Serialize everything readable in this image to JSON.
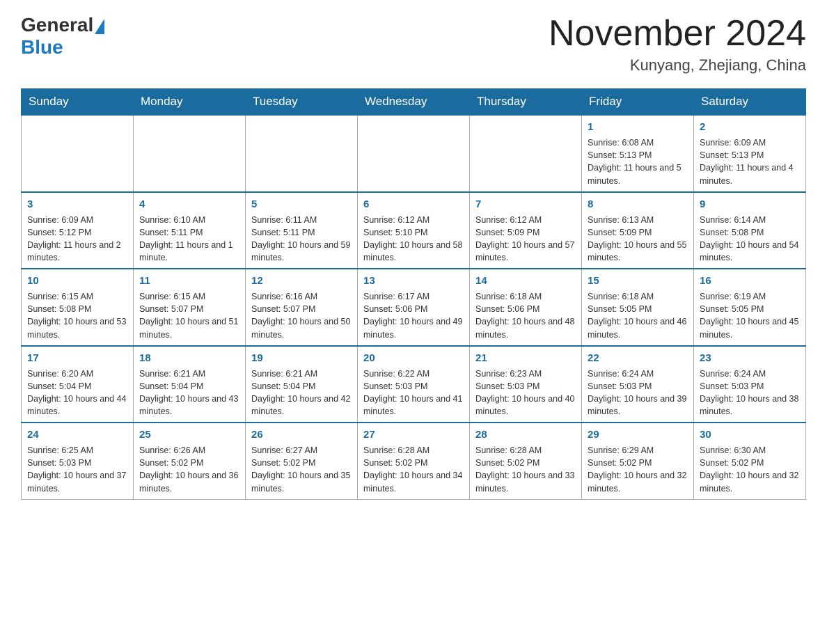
{
  "logo": {
    "general": "General",
    "blue": "Blue"
  },
  "title": "November 2024",
  "location": "Kunyang, Zhejiang, China",
  "weekdays": [
    "Sunday",
    "Monday",
    "Tuesday",
    "Wednesday",
    "Thursday",
    "Friday",
    "Saturday"
  ],
  "weeks": [
    [
      {
        "day": "",
        "info": ""
      },
      {
        "day": "",
        "info": ""
      },
      {
        "day": "",
        "info": ""
      },
      {
        "day": "",
        "info": ""
      },
      {
        "day": "",
        "info": ""
      },
      {
        "day": "1",
        "info": "Sunrise: 6:08 AM\nSunset: 5:13 PM\nDaylight: 11 hours and 5 minutes."
      },
      {
        "day": "2",
        "info": "Sunrise: 6:09 AM\nSunset: 5:13 PM\nDaylight: 11 hours and 4 minutes."
      }
    ],
    [
      {
        "day": "3",
        "info": "Sunrise: 6:09 AM\nSunset: 5:12 PM\nDaylight: 11 hours and 2 minutes."
      },
      {
        "day": "4",
        "info": "Sunrise: 6:10 AM\nSunset: 5:11 PM\nDaylight: 11 hours and 1 minute."
      },
      {
        "day": "5",
        "info": "Sunrise: 6:11 AM\nSunset: 5:11 PM\nDaylight: 10 hours and 59 minutes."
      },
      {
        "day": "6",
        "info": "Sunrise: 6:12 AM\nSunset: 5:10 PM\nDaylight: 10 hours and 58 minutes."
      },
      {
        "day": "7",
        "info": "Sunrise: 6:12 AM\nSunset: 5:09 PM\nDaylight: 10 hours and 57 minutes."
      },
      {
        "day": "8",
        "info": "Sunrise: 6:13 AM\nSunset: 5:09 PM\nDaylight: 10 hours and 55 minutes."
      },
      {
        "day": "9",
        "info": "Sunrise: 6:14 AM\nSunset: 5:08 PM\nDaylight: 10 hours and 54 minutes."
      }
    ],
    [
      {
        "day": "10",
        "info": "Sunrise: 6:15 AM\nSunset: 5:08 PM\nDaylight: 10 hours and 53 minutes."
      },
      {
        "day": "11",
        "info": "Sunrise: 6:15 AM\nSunset: 5:07 PM\nDaylight: 10 hours and 51 minutes."
      },
      {
        "day": "12",
        "info": "Sunrise: 6:16 AM\nSunset: 5:07 PM\nDaylight: 10 hours and 50 minutes."
      },
      {
        "day": "13",
        "info": "Sunrise: 6:17 AM\nSunset: 5:06 PM\nDaylight: 10 hours and 49 minutes."
      },
      {
        "day": "14",
        "info": "Sunrise: 6:18 AM\nSunset: 5:06 PM\nDaylight: 10 hours and 48 minutes."
      },
      {
        "day": "15",
        "info": "Sunrise: 6:18 AM\nSunset: 5:05 PM\nDaylight: 10 hours and 46 minutes."
      },
      {
        "day": "16",
        "info": "Sunrise: 6:19 AM\nSunset: 5:05 PM\nDaylight: 10 hours and 45 minutes."
      }
    ],
    [
      {
        "day": "17",
        "info": "Sunrise: 6:20 AM\nSunset: 5:04 PM\nDaylight: 10 hours and 44 minutes."
      },
      {
        "day": "18",
        "info": "Sunrise: 6:21 AM\nSunset: 5:04 PM\nDaylight: 10 hours and 43 minutes."
      },
      {
        "day": "19",
        "info": "Sunrise: 6:21 AM\nSunset: 5:04 PM\nDaylight: 10 hours and 42 minutes."
      },
      {
        "day": "20",
        "info": "Sunrise: 6:22 AM\nSunset: 5:03 PM\nDaylight: 10 hours and 41 minutes."
      },
      {
        "day": "21",
        "info": "Sunrise: 6:23 AM\nSunset: 5:03 PM\nDaylight: 10 hours and 40 minutes."
      },
      {
        "day": "22",
        "info": "Sunrise: 6:24 AM\nSunset: 5:03 PM\nDaylight: 10 hours and 39 minutes."
      },
      {
        "day": "23",
        "info": "Sunrise: 6:24 AM\nSunset: 5:03 PM\nDaylight: 10 hours and 38 minutes."
      }
    ],
    [
      {
        "day": "24",
        "info": "Sunrise: 6:25 AM\nSunset: 5:03 PM\nDaylight: 10 hours and 37 minutes."
      },
      {
        "day": "25",
        "info": "Sunrise: 6:26 AM\nSunset: 5:02 PM\nDaylight: 10 hours and 36 minutes."
      },
      {
        "day": "26",
        "info": "Sunrise: 6:27 AM\nSunset: 5:02 PM\nDaylight: 10 hours and 35 minutes."
      },
      {
        "day": "27",
        "info": "Sunrise: 6:28 AM\nSunset: 5:02 PM\nDaylight: 10 hours and 34 minutes."
      },
      {
        "day": "28",
        "info": "Sunrise: 6:28 AM\nSunset: 5:02 PM\nDaylight: 10 hours and 33 minutes."
      },
      {
        "day": "29",
        "info": "Sunrise: 6:29 AM\nSunset: 5:02 PM\nDaylight: 10 hours and 32 minutes."
      },
      {
        "day": "30",
        "info": "Sunrise: 6:30 AM\nSunset: 5:02 PM\nDaylight: 10 hours and 32 minutes."
      }
    ]
  ]
}
